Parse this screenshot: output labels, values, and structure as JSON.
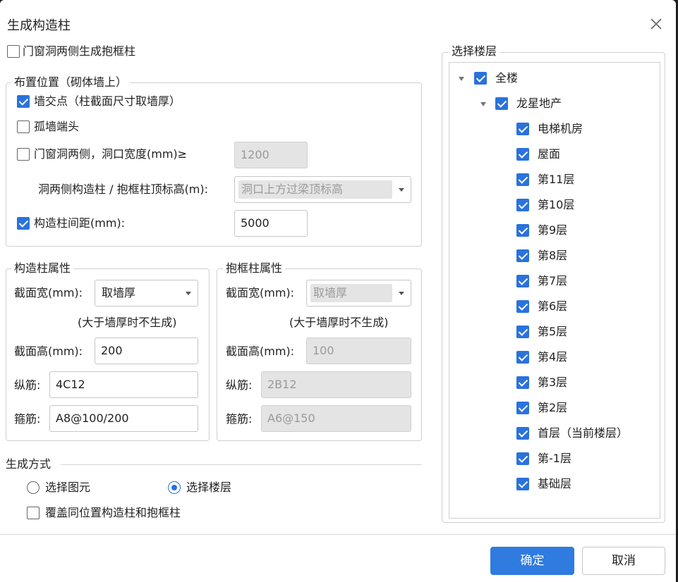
{
  "dialog": {
    "title": "生成构造柱",
    "confirm_label": "确定",
    "cancel_label": "取消"
  },
  "options": {
    "door_window_frame_label": "门窗洞两侧生成抱框柱",
    "door_window_frame_checked": false
  },
  "placement": {
    "legend": "布置位置（砌体墙上）",
    "wall_intersection_label": "墙交点（柱截面尺寸取墙厚）",
    "wall_intersection_checked": true,
    "isolated_wall_end_label": "孤墙端头",
    "isolated_wall_end_checked": false,
    "opening_sides_label": "门窗洞两侧，洞口宽度(mm)≥",
    "opening_sides_checked": false,
    "opening_width_value": "1200",
    "top_elevation_label": "洞两侧构造柱 / 抱框柱顶标高(m):",
    "top_elevation_value": "洞口上方过梁顶标高",
    "spacing_label": "构造柱间距(mm):",
    "spacing_checked": true,
    "spacing_value": "5000"
  },
  "column_props": {
    "legend": "构造柱属性",
    "width_label": "截面宽(mm):",
    "width_value": "取墙厚",
    "note": "(大于墙厚时不生成)",
    "height_label": "截面高(mm):",
    "height_value": "200",
    "long_bar_label": "纵筋:",
    "long_bar_value": "4C12",
    "stirrup_label": "箍筋:",
    "stirrup_value": "A8@100/200"
  },
  "frame_props": {
    "legend": "抱框柱属性",
    "width_label": "截面宽(mm):",
    "width_value": "取墙厚",
    "note": "(大于墙厚时不生成)",
    "height_label": "截面高(mm):",
    "height_value": "100",
    "long_bar_label": "纵筋:",
    "long_bar_value": "2B12",
    "stirrup_label": "箍筋:",
    "stirrup_value": "A6@150"
  },
  "generation": {
    "legend": "生成方式",
    "select_element_label": "选择图元",
    "select_element_checked": false,
    "select_floor_label": "选择楼层",
    "select_floor_checked": true,
    "overwrite_label": "覆盖同位置构造柱和抱框柱",
    "overwrite_checked": false
  },
  "floors": {
    "legend": "选择楼层",
    "root_label": "全楼",
    "project_label": "龙星地产",
    "items": [
      "电梯机房",
      "屋面",
      "第11层",
      "第10层",
      "第9层",
      "第8层",
      "第7层",
      "第6层",
      "第5层",
      "第4层",
      "第3层",
      "第2层",
      "首层（当前楼层）",
      "第-1层",
      "基础层"
    ]
  },
  "colors": {
    "accent": "#2a72dc",
    "primary_button": "#2f7be0",
    "disabled_field": "#e4e4e4"
  }
}
